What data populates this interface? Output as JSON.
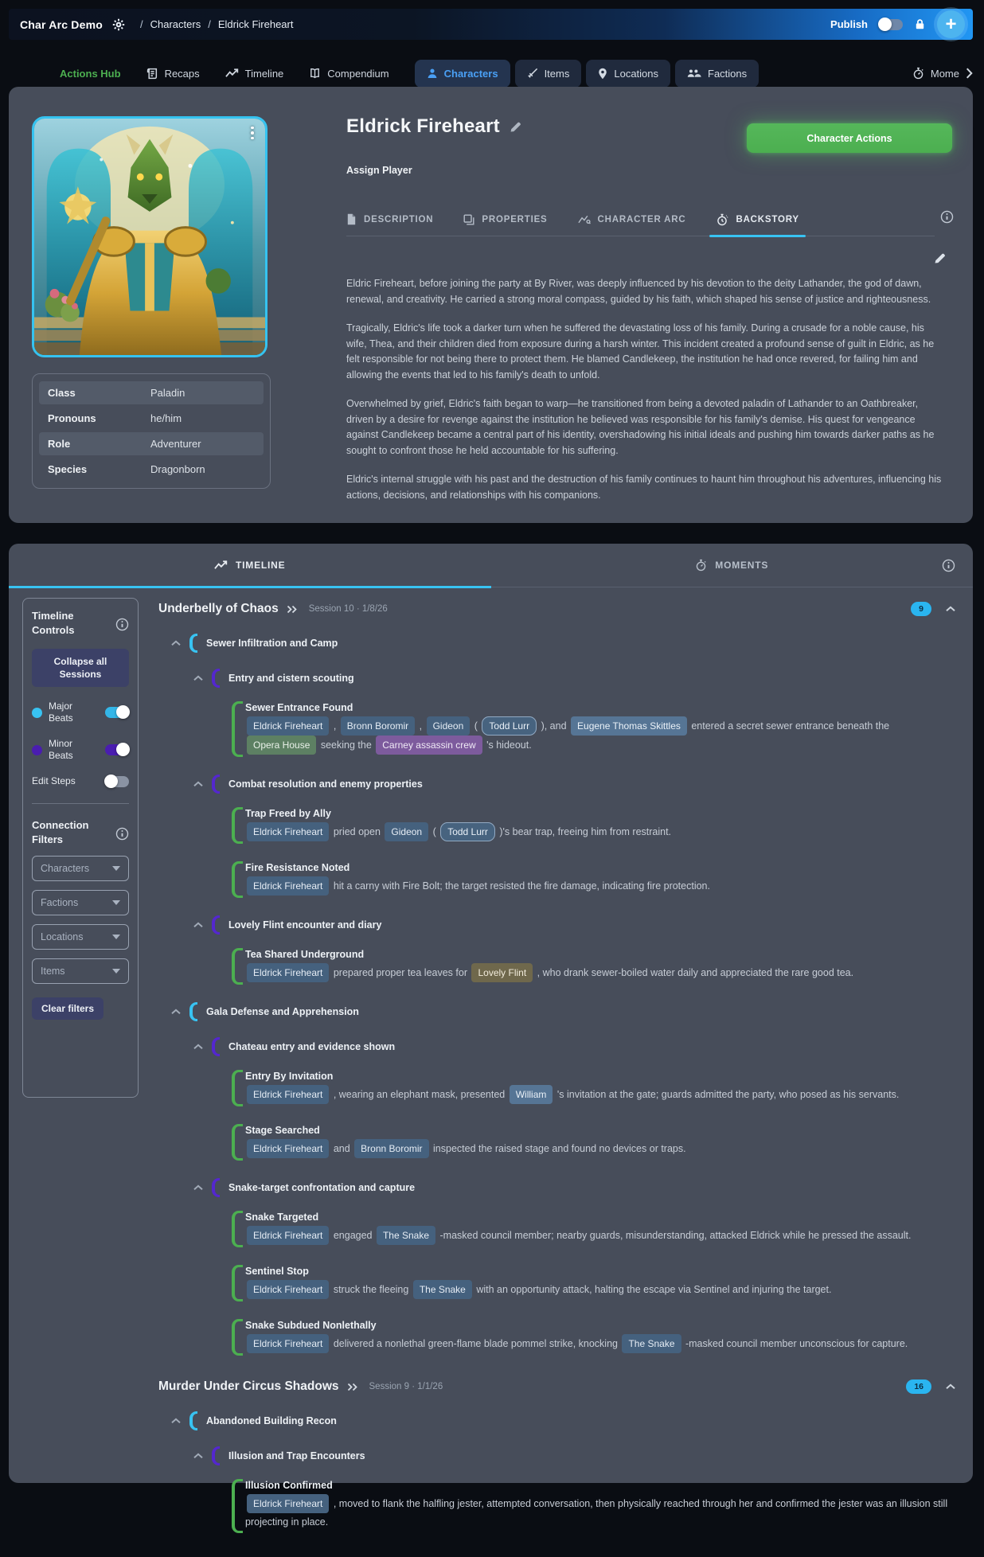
{
  "colors": {
    "accent_cyan": "#38C3F2",
    "publish_blue": "#2196F3",
    "action_green": "#4CAF50",
    "beat_green": "#4CAF50",
    "minor_purple": "#5427CF",
    "badge_cyan": "#2AB5F0"
  },
  "navbar": {
    "app_title": "Char Arc Demo",
    "breadcrumb": [
      "Characters",
      "Eldrick Fireheart"
    ],
    "publish_label": "Publish",
    "publish_on": false
  },
  "nav_tabs": {
    "items": [
      {
        "label": "Actions Hub",
        "icon": null,
        "variant": "plain",
        "accent": "green",
        "active": false
      },
      {
        "label": "Recaps",
        "icon": "recap-icon",
        "variant": "plain",
        "active": false
      },
      {
        "label": "Timeline",
        "icon": "trending-icon",
        "variant": "plain",
        "active": false
      },
      {
        "label": "Compendium",
        "icon": "book-icon",
        "variant": "plain",
        "active": false
      },
      {
        "label": "Characters",
        "icon": "person-icon",
        "variant": "boxed",
        "active": true
      },
      {
        "label": "Items",
        "icon": "sword-icon",
        "variant": "boxed",
        "active": false
      },
      {
        "label": "Locations",
        "icon": "pin-icon",
        "variant": "boxed",
        "active": false
      },
      {
        "label": "Factions",
        "icon": "people-icon",
        "variant": "boxed",
        "active": false
      },
      {
        "label": "Mome",
        "icon": "stopwatch-icon",
        "variant": "plain",
        "active": false,
        "last": true
      }
    ]
  },
  "character": {
    "name": "Eldrick Fireheart",
    "assign_player_label": "Assign Player",
    "actions_button_label": "Character Actions",
    "tabs": [
      {
        "label": "DESCRIPTION",
        "icon": "document-icon",
        "active": false
      },
      {
        "label": "PROPERTIES",
        "icon": "properties-icon",
        "active": false
      },
      {
        "label": "CHARACTER ARC",
        "icon": "arc-chart-icon",
        "active": false
      },
      {
        "label": "BACKSTORY",
        "icon": "watch-icon",
        "active": true
      }
    ],
    "info_rows": [
      {
        "label": "Class",
        "value": "Paladin"
      },
      {
        "label": "Pronouns",
        "value": "he/him"
      },
      {
        "label": "Role",
        "value": "Adventurer"
      },
      {
        "label": "Species",
        "value": "Dragonborn"
      }
    ],
    "backstory_paragraphs": [
      "Eldric Fireheart, before joining the party at By River, was deeply influenced by his devotion to the deity Lathander, the god of dawn, renewal, and creativity. He carried a strong moral compass, guided by his faith, which shaped his sense of justice and righteousness.",
      "Tragically, Eldric's life took a darker turn when he suffered the devastating loss of his family. During a crusade for a noble cause, his wife, Thea, and their children died from exposure during a harsh winter. This incident created a profound sense of guilt in Eldric, as he felt responsible for not being there to protect them. He blamed Candlekeep, the institution he had once revered, for failing him and allowing the events that led to his family's death to unfold.",
      "Overwhelmed by grief, Eldric's faith began to warp—he transitioned from being a devoted paladin of Lathander to an Oathbreaker, driven by a desire for revenge against the institution he believed was responsible for his family's demise. His quest for vengeance against Candlekeep became a central part of his identity, overshadowing his initial ideals and pushing him towards darker paths as he sought to confront those he held accountable for his suffering.",
      "Eldric's internal struggle with his past and the destruction of his family continues to haunt him throughout his adventures, influencing his actions, decisions, and relationships with his companions."
    ]
  },
  "timeline_panel": {
    "tabs": [
      {
        "label": "TIMELINE",
        "icon": "trending-icon",
        "active": true
      },
      {
        "label": "MOMENTS",
        "icon": "stopwatch-icon",
        "active": false
      }
    ],
    "controls": {
      "heading": "Timeline Controls",
      "collapse_button_label": "Collapse all Sessions",
      "toggles": [
        {
          "label": "Major Beats",
          "dot_color": "#38C3F2",
          "on": true,
          "track_color": "#34B6E8"
        },
        {
          "label": "Minor Beats",
          "dot_color": "#4A1DB0",
          "on": true,
          "track_color": "#4A1DB0"
        },
        {
          "label": "Edit Steps",
          "dot_color": null,
          "on": false,
          "track_color": "#8A93A3"
        }
      ]
    },
    "filters": {
      "heading": "Connection Filters",
      "dropdowns": [
        "Characters",
        "Factions",
        "Locations",
        "Items"
      ],
      "clear_button_label": "Clear filters"
    },
    "sessions": [
      {
        "title": "Underbelly of Chaos",
        "meta": "Session 10 · 1/8/26",
        "badge": "9",
        "rows": [
          {
            "type": "group1",
            "title": "Sewer Infiltration and Camp"
          },
          {
            "type": "group2",
            "title": "Entry and cistern scouting"
          },
          {
            "type": "beat",
            "title": "Sewer Entrance Found",
            "body": [
              [
                "chip-character",
                "Eldrick Fireheart"
              ],
              [
                "text",
                " , "
              ],
              [
                "chip-character",
                "Bronn Boromir"
              ],
              [
                "text",
                " , "
              ],
              [
                "chip-character",
                "Gideon"
              ],
              [
                "text",
                " ( "
              ],
              [
                "chip-player",
                "Todd Lurr"
              ],
              [
                "text",
                " ), and "
              ],
              [
                "chip-npc",
                "Eugene Thomas Skittles"
              ],
              [
                "text",
                " entered a secret sewer entrance beneath the "
              ],
              [
                "chip-location",
                "Opera House"
              ],
              [
                "text",
                " seeking the "
              ],
              [
                "chip-faction",
                "Carney assassin crew"
              ],
              [
                "text",
                " 's hideout."
              ]
            ]
          },
          {
            "type": "group2",
            "title": "Combat resolution and enemy properties"
          },
          {
            "type": "beat",
            "title": "Trap Freed by Ally",
            "body": [
              [
                "chip-character",
                "Eldrick Fireheart"
              ],
              [
                "text",
                " pried open "
              ],
              [
                "chip-character",
                "Gideon"
              ],
              [
                "text",
                " ( "
              ],
              [
                "chip-player",
                "Todd Lurr"
              ],
              [
                "text",
                " )'s bear trap, freeing him from restraint."
              ]
            ]
          },
          {
            "type": "beat",
            "title": "Fire Resistance Noted",
            "body": [
              [
                "chip-character",
                "Eldrick Fireheart"
              ],
              [
                "text",
                " hit a carny with Fire Bolt; the target resisted the fire damage, indicating fire protection."
              ]
            ]
          },
          {
            "type": "group2",
            "title": "Lovely Flint encounter and diary"
          },
          {
            "type": "beat",
            "title": "Tea Shared Underground",
            "body": [
              [
                "chip-character",
                "Eldrick Fireheart"
              ],
              [
                "text",
                " prepared proper tea leaves for "
              ],
              [
                "chip-amber",
                "Lovely Flint"
              ],
              [
                "text",
                " , who drank sewer-boiled water daily and appreciated the rare good tea."
              ]
            ]
          },
          {
            "type": "group1",
            "title": "Gala Defense and Apprehension"
          },
          {
            "type": "group2",
            "title": "Chateau entry and evidence shown"
          },
          {
            "type": "beat",
            "title": "Entry By Invitation",
            "body": [
              [
                "chip-character",
                "Eldrick Fireheart"
              ],
              [
                "text",
                " , wearing an elephant mask, presented "
              ],
              [
                "chip-npc",
                "William"
              ],
              [
                "text",
                " 's invitation at the gate; guards admitted the party, who posed as his servants."
              ]
            ]
          },
          {
            "type": "beat",
            "title": "Stage Searched",
            "body": [
              [
                "chip-character",
                "Eldrick Fireheart"
              ],
              [
                "text",
                " and "
              ],
              [
                "chip-character",
                "Bronn Boromir"
              ],
              [
                "text",
                " inspected the raised stage and found no devices or traps."
              ]
            ]
          },
          {
            "type": "group2",
            "title": "Snake-target confrontation and capture"
          },
          {
            "type": "beat",
            "title": "Snake Targeted",
            "body": [
              [
                "chip-character",
                "Eldrick Fireheart"
              ],
              [
                "text",
                " engaged "
              ],
              [
                "chip-character",
                "The Snake"
              ],
              [
                "text",
                " -masked council member; nearby guards, misunderstanding, attacked Eldrick while he pressed the assault."
              ]
            ]
          },
          {
            "type": "beat",
            "title": "Sentinel Stop",
            "body": [
              [
                "chip-character",
                "Eldrick Fireheart"
              ],
              [
                "text",
                " struck the fleeing "
              ],
              [
                "chip-character",
                "The Snake"
              ],
              [
                "text",
                " with an opportunity attack, halting the escape via Sentinel and injuring the target."
              ]
            ]
          },
          {
            "type": "beat",
            "title": "Snake Subdued Nonlethally",
            "body": [
              [
                "chip-character",
                "Eldrick Fireheart"
              ],
              [
                "text",
                " delivered a nonlethal green-flame blade pommel strike, knocking "
              ],
              [
                "chip-character",
                "The Snake"
              ],
              [
                "text",
                " -masked council member unconscious for capture."
              ]
            ]
          }
        ]
      },
      {
        "title": "Murder Under Circus Shadows",
        "meta": "Session 9 · 1/1/26",
        "badge": "16",
        "rows": [
          {
            "type": "group1",
            "title": "Abandoned Building Recon"
          },
          {
            "type": "group2",
            "title": "Illusion and Trap Encounters"
          },
          {
            "type": "beat",
            "title": "Illusion Confirmed",
            "body": [
              [
                "chip-character",
                "Eldrick Fireheart"
              ],
              [
                "text",
                " , moved to flank the halfling jester, attempted conversation, then physically reached through her and confirmed the jester was an illusion still projecting in place."
              ]
            ]
          }
        ]
      }
    ]
  }
}
